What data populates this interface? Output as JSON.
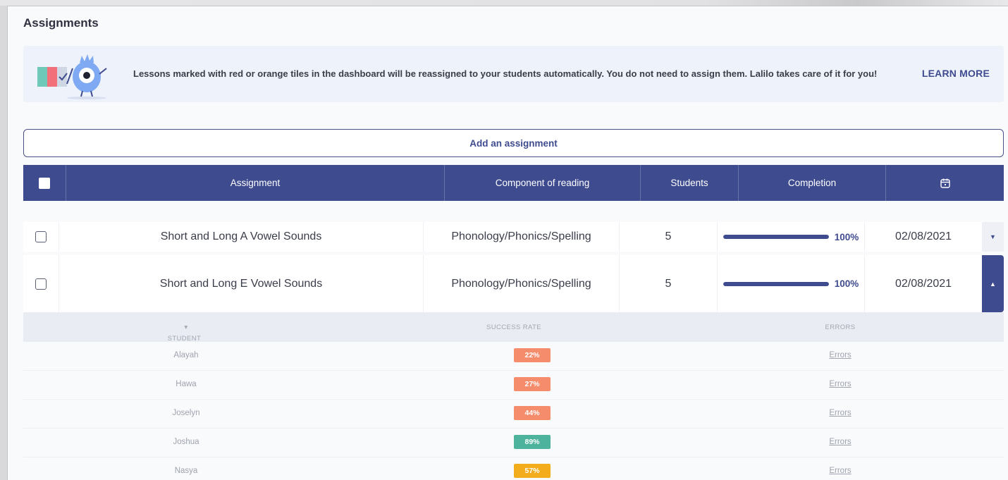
{
  "page": {
    "title": "Assignments"
  },
  "banner": {
    "text": "Lessons marked with red or orange tiles in the dashboard will be reassigned to your students automatically. You do not need to assign them. Lalilo takes care of it for you!",
    "learn_more": "LEARN MORE"
  },
  "add_button": {
    "label": "Add an assignment"
  },
  "table": {
    "headers": {
      "assignment": "Assignment",
      "component": "Component of reading",
      "students": "Students",
      "completion": "Completion",
      "date_icon": "calendar-icon"
    },
    "rows": [
      {
        "assignment": "Short and Long A Vowel Sounds",
        "component": "Phonology/Phonics/Spelling",
        "students": "5",
        "completion": 1.0,
        "completion_label": "100%",
        "date": "02/08/2021",
        "expanded": false
      },
      {
        "assignment": "Short and Long E Vowel Sounds",
        "component": "Phonology/Phonics/Spelling",
        "students": "5",
        "completion": 1.0,
        "completion_label": "100%",
        "date": "02/08/2021",
        "expanded": true
      }
    ]
  },
  "details": {
    "headers": {
      "student": "STUDENT",
      "success_rate": "SUCCESS RATE",
      "errors": "ERRORS"
    },
    "rows": [
      {
        "student": "Alayah",
        "rate": "22%",
        "color": "#f58c6c",
        "errors": "Errors"
      },
      {
        "student": "Hawa",
        "rate": "27%",
        "color": "#f58c6c",
        "errors": "Errors"
      },
      {
        "student": "Joselyn",
        "rate": "44%",
        "color": "#f58c6c",
        "errors": "Errors"
      },
      {
        "student": "Joshua",
        "rate": "89%",
        "color": "#4db39c",
        "errors": "Errors"
      },
      {
        "student": "Nasya",
        "rate": "57%",
        "color": "#f2ac1c",
        "errors": "Errors"
      }
    ]
  },
  "colors": {
    "primary": "#3f4b8f",
    "banner_bg": "#edf2fb"
  }
}
